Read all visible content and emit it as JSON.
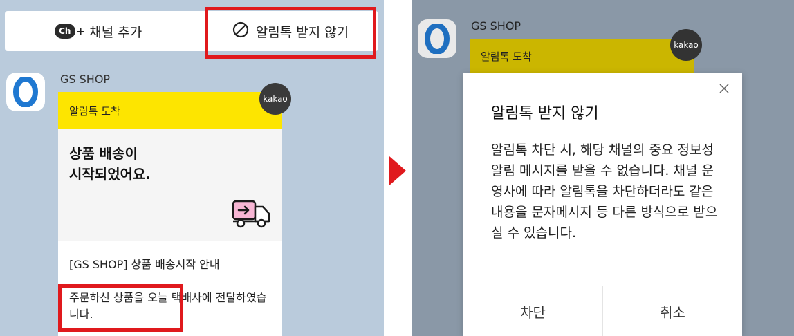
{
  "left": {
    "add_channel": {
      "label": "채널 추가",
      "icon": "ch-plus-icon",
      "icon_text": "Ch"
    },
    "block_alimtalk": {
      "label": "알림톡 받지 않기",
      "icon": "prohibited-icon"
    },
    "sender": "GS SHOP",
    "kakao_badge": "kakao",
    "card": {
      "header": "알림톡 도착",
      "title_line1": "상품 배송이",
      "title_line2": "시작되었어요.",
      "icon": "delivery-truck-icon",
      "text1": "[GS SHOP] 상품 배송시작 안내",
      "text2": "주문하신 상품을 오늘 택배사에 전달하였습니다."
    }
  },
  "right": {
    "sender": "GS SHOP",
    "kakao_badge": "kakao",
    "card_header": "알림톡 도착",
    "dialog": {
      "title": "알림톡 받지 않기",
      "body": "알림톡 차단 시, 해당 채널의 중요 정보성 알림 메시지를 받을 수 없습니다. 채널 운영사에 따라 알림톡을 차단하더라도 같은 내용을 문자메시지 등 다른 방식으로 받으실 수 있습니다.",
      "confirm_label": "차단",
      "cancel_label": "취소"
    }
  },
  "colors": {
    "highlight": "#e0191d",
    "kakao_yellow": "#fde500",
    "chat_bg_left": "#bacbdc",
    "chat_bg_right_dimmed": "#8a98a7",
    "gs_blue": "#1f78d1"
  }
}
